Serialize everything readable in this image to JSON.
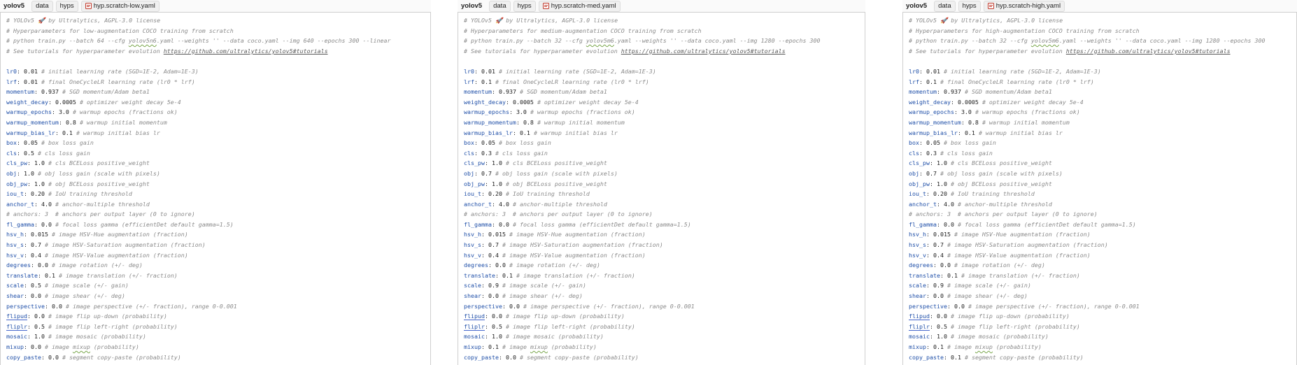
{
  "panels": [
    {
      "breadcrumb": [
        "yolov5",
        "data",
        "hyps",
        "hyp.scratch-low.yaml"
      ],
      "header": [
        "# YOLOv5 🚀 by Ultralytics, AGPL-3.0 license",
        "# Hyperparameters for low-augmentation COCO training from scratch",
        "# python train.py --batch 64 --cfg yolov5n6.yaml --weights '' --data coco.yaml --img 640 --epochs 300 --linear",
        "# See tutorials for hyperparameter evolution "
      ],
      "url": "https://github.com/ultralytics/yolov5#tutorials",
      "params": [
        {
          "key": "lr0",
          "val": "0.01",
          "comment": "# initial learning rate (SGD=1E-2, Adam=1E-3)"
        },
        {
          "key": "lrf",
          "val": "0.01",
          "comment": "# final OneCycleLR learning rate (lr0 * lrf)"
        },
        {
          "key": "momentum",
          "val": "0.937",
          "comment": "# SGD momentum/Adam beta1"
        },
        {
          "key": "weight_decay",
          "val": "0.0005",
          "comment": "# optimizer weight decay 5e-4"
        },
        {
          "key": "warmup_epochs",
          "val": "3.0",
          "comment": "# warmup epochs (fractions ok)"
        },
        {
          "key": "warmup_momentum",
          "val": "0.8",
          "comment": "# warmup initial momentum"
        },
        {
          "key": "warmup_bias_lr",
          "val": "0.1",
          "comment": "# warmup initial bias lr"
        },
        {
          "key": "box",
          "val": "0.05",
          "comment": "# box loss gain"
        },
        {
          "key": "cls",
          "val": "0.5",
          "comment": "# cls loss gain"
        },
        {
          "key": "cls_pw",
          "val": "1.0",
          "comment": "# cls BCELoss positive_weight"
        },
        {
          "key": "obj",
          "val": "1.0",
          "comment": "# obj loss gain (scale with pixels)"
        },
        {
          "key": "obj_pw",
          "val": "1.0",
          "comment": "# obj BCELoss positive_weight"
        },
        {
          "key": "iou_t",
          "val": "0.20",
          "comment": "# IoU training threshold"
        },
        {
          "key": "anchor_t",
          "val": "4.0",
          "comment": "# anchor-multiple threshold"
        },
        {
          "comment_line": "# anchors: 3  # anchors per output layer (0 to ignore)"
        },
        {
          "key": "fl_gamma",
          "val": "0.0",
          "comment": "# focal loss gamma (efficientDet default gamma=1.5)"
        },
        {
          "key": "hsv_h",
          "val": "0.015",
          "comment": "# image HSV-Hue augmentation (fraction)"
        },
        {
          "key": "hsv_s",
          "val": "0.7",
          "comment": "# image HSV-Saturation augmentation (fraction)"
        },
        {
          "key": "hsv_v",
          "val": "0.4",
          "comment": "# image HSV-Value augmentation (fraction)"
        },
        {
          "key": "degrees",
          "val": "0.0",
          "comment": "# image rotation (+/- deg)"
        },
        {
          "key": "translate",
          "val": "0.1",
          "comment": "# image translation (+/- fraction)"
        },
        {
          "key": "scale",
          "val": "0.5",
          "comment": "# image scale (+/- gain)"
        },
        {
          "key": "shear",
          "val": "0.0",
          "comment": "# image shear (+/- deg)"
        },
        {
          "key": "perspective",
          "val": "0.0",
          "comment": "# image perspective (+/- fraction), range 0-0.001"
        },
        {
          "key": "flipud",
          "val": "0.0",
          "comment": "# image flip up-down (probability)"
        },
        {
          "key": "fliplr",
          "val": "0.5",
          "comment": "# image flip left-right (probability)"
        },
        {
          "key": "mosaic",
          "val": "1.0",
          "comment": "# image mosaic (probability)"
        },
        {
          "key": "mixup",
          "val": "0.0",
          "comment": "# image mixup (probability)"
        },
        {
          "key": "copy_paste",
          "val": "0.0",
          "comment": "# segment copy-paste (probability)"
        }
      ]
    },
    {
      "breadcrumb": [
        "yolov5",
        "data",
        "hyps",
        "hyp.scratch-med.yaml"
      ],
      "header": [
        "# YOLOv5 🚀 by Ultralytics, AGPL-3.0 license",
        "# Hyperparameters for medium-augmentation COCO training from scratch",
        "# python train.py --batch 32 --cfg yolov5m6.yaml --weights '' --data coco.yaml --img 1280 --epochs 300",
        "# See tutorials for hyperparameter evolution "
      ],
      "url": "https://github.com/ultralytics/yolov5#tutorials",
      "params": [
        {
          "key": "lr0",
          "val": "0.01",
          "comment": "# initial learning rate (SGD=1E-2, Adam=1E-3)"
        },
        {
          "key": "lrf",
          "val": "0.1",
          "comment": "# final OneCycleLR learning rate (lr0 * lrf)"
        },
        {
          "key": "momentum",
          "val": "0.937",
          "comment": "# SGD momentum/Adam beta1"
        },
        {
          "key": "weight_decay",
          "val": "0.0005",
          "comment": "# optimizer weight decay 5e-4"
        },
        {
          "key": "warmup_epochs",
          "val": "3.0",
          "comment": "# warmup epochs (fractions ok)"
        },
        {
          "key": "warmup_momentum",
          "val": "0.8",
          "comment": "# warmup initial momentum"
        },
        {
          "key": "warmup_bias_lr",
          "val": "0.1",
          "comment": "# warmup initial bias lr"
        },
        {
          "key": "box",
          "val": "0.05",
          "comment": "# box loss gain"
        },
        {
          "key": "cls",
          "val": "0.3",
          "comment": "# cls loss gain"
        },
        {
          "key": "cls_pw",
          "val": "1.0",
          "comment": "# cls BCELoss positive_weight"
        },
        {
          "key": "obj",
          "val": "0.7",
          "comment": "# obj loss gain (scale with pixels)"
        },
        {
          "key": "obj_pw",
          "val": "1.0",
          "comment": "# obj BCELoss positive_weight"
        },
        {
          "key": "iou_t",
          "val": "0.20",
          "comment": "# IoU training threshold"
        },
        {
          "key": "anchor_t",
          "val": "4.0",
          "comment": "# anchor-multiple threshold"
        },
        {
          "comment_line": "# anchors: 3  # anchors per output layer (0 to ignore)"
        },
        {
          "key": "fl_gamma",
          "val": "0.0",
          "comment": "# focal loss gamma (efficientDet default gamma=1.5)"
        },
        {
          "key": "hsv_h",
          "val": "0.015",
          "comment": "# image HSV-Hue augmentation (fraction)"
        },
        {
          "key": "hsv_s",
          "val": "0.7",
          "comment": "# image HSV-Saturation augmentation (fraction)"
        },
        {
          "key": "hsv_v",
          "val": "0.4",
          "comment": "# image HSV-Value augmentation (fraction)"
        },
        {
          "key": "degrees",
          "val": "0.0",
          "comment": "# image rotation (+/- deg)"
        },
        {
          "key": "translate",
          "val": "0.1",
          "comment": "# image translation (+/- fraction)"
        },
        {
          "key": "scale",
          "val": "0.9",
          "comment": "# image scale (+/- gain)"
        },
        {
          "key": "shear",
          "val": "0.0",
          "comment": "# image shear (+/- deg)"
        },
        {
          "key": "perspective",
          "val": "0.0",
          "comment": "# image perspective (+/- fraction), range 0-0.001"
        },
        {
          "key": "flipud",
          "val": "0.0",
          "comment": "# image flip up-down (probability)"
        },
        {
          "key": "fliplr",
          "val": "0.5",
          "comment": "# image flip left-right (probability)"
        },
        {
          "key": "mosaic",
          "val": "1.0",
          "comment": "# image mosaic (probability)"
        },
        {
          "key": "mixup",
          "val": "0.1",
          "comment": "# image mixup (probability)"
        },
        {
          "key": "copy_paste",
          "val": "0.0",
          "comment": "# segment copy-paste (probability)"
        }
      ]
    },
    {
      "breadcrumb": [
        "yolov5",
        "data",
        "hyps",
        "hyp.scratch-high.yaml"
      ],
      "header": [
        "# YOLOv5 🚀 by Ultralytics, AGPL-3.0 license",
        "# Hyperparameters for high-augmentation COCO training from scratch",
        "# python train.py --batch 32 --cfg yolov5m6.yaml --weights '' --data coco.yaml --img 1280 --epochs 300",
        "# See tutorials for hyperparameter evolution "
      ],
      "url": "https://github.com/ultralytics/yolov5#tutorials",
      "params": [
        {
          "key": "lr0",
          "val": "0.01",
          "comment": "# initial learning rate (SGD=1E-2, Adam=1E-3)"
        },
        {
          "key": "lrf",
          "val": "0.1",
          "comment": "# final OneCycleLR learning rate (lr0 * lrf)"
        },
        {
          "key": "momentum",
          "val": "0.937",
          "comment": "# SGD momentum/Adam beta1"
        },
        {
          "key": "weight_decay",
          "val": "0.0005",
          "comment": "# optimizer weight decay 5e-4"
        },
        {
          "key": "warmup_epochs",
          "val": "3.0",
          "comment": "# warmup epochs (fractions ok)"
        },
        {
          "key": "warmup_momentum",
          "val": "0.8",
          "comment": "# warmup initial momentum"
        },
        {
          "key": "warmup_bias_lr",
          "val": "0.1",
          "comment": "# warmup initial bias lr"
        },
        {
          "key": "box",
          "val": "0.05",
          "comment": "# box loss gain"
        },
        {
          "key": "cls",
          "val": "0.3",
          "comment": "# cls loss gain"
        },
        {
          "key": "cls_pw",
          "val": "1.0",
          "comment": "# cls BCELoss positive_weight"
        },
        {
          "key": "obj",
          "val": "0.7",
          "comment": "# obj loss gain (scale with pixels)"
        },
        {
          "key": "obj_pw",
          "val": "1.0",
          "comment": "# obj BCELoss positive_weight"
        },
        {
          "key": "iou_t",
          "val": "0.20",
          "comment": "# IoU training threshold"
        },
        {
          "key": "anchor_t",
          "val": "4.0",
          "comment": "# anchor-multiple threshold"
        },
        {
          "comment_line": "# anchors: 3  # anchors per output layer (0 to ignore)"
        },
        {
          "key": "fl_gamma",
          "val": "0.0",
          "comment": "# focal loss gamma (efficientDet default gamma=1.5)"
        },
        {
          "key": "hsv_h",
          "val": "0.015",
          "comment": "# image HSV-Hue augmentation (fraction)"
        },
        {
          "key": "hsv_s",
          "val": "0.7",
          "comment": "# image HSV-Saturation augmentation (fraction)"
        },
        {
          "key": "hsv_v",
          "val": "0.4",
          "comment": "# image HSV-Value augmentation (fraction)"
        },
        {
          "key": "degrees",
          "val": "0.0",
          "comment": "# image rotation (+/- deg)"
        },
        {
          "key": "translate",
          "val": "0.1",
          "comment": "# image translation (+/- fraction)"
        },
        {
          "key": "scale",
          "val": "0.9",
          "comment": "# image scale (+/- gain)"
        },
        {
          "key": "shear",
          "val": "0.0",
          "comment": "# image shear (+/- deg)"
        },
        {
          "key": "perspective",
          "val": "0.0",
          "comment": "# image perspective (+/- fraction), range 0-0.001"
        },
        {
          "key": "flipud",
          "val": "0.0",
          "comment": "# image flip up-down (probability)"
        },
        {
          "key": "fliplr",
          "val": "0.5",
          "comment": "# image flip left-right (probability)"
        },
        {
          "key": "mosaic",
          "val": "1.0",
          "comment": "# image mosaic (probability)"
        },
        {
          "key": "mixup",
          "val": "0.1",
          "comment": "# image mixup (probability)"
        },
        {
          "key": "copy_paste",
          "val": "0.1",
          "comment": "# segment copy-paste (probability)"
        }
      ]
    }
  ]
}
